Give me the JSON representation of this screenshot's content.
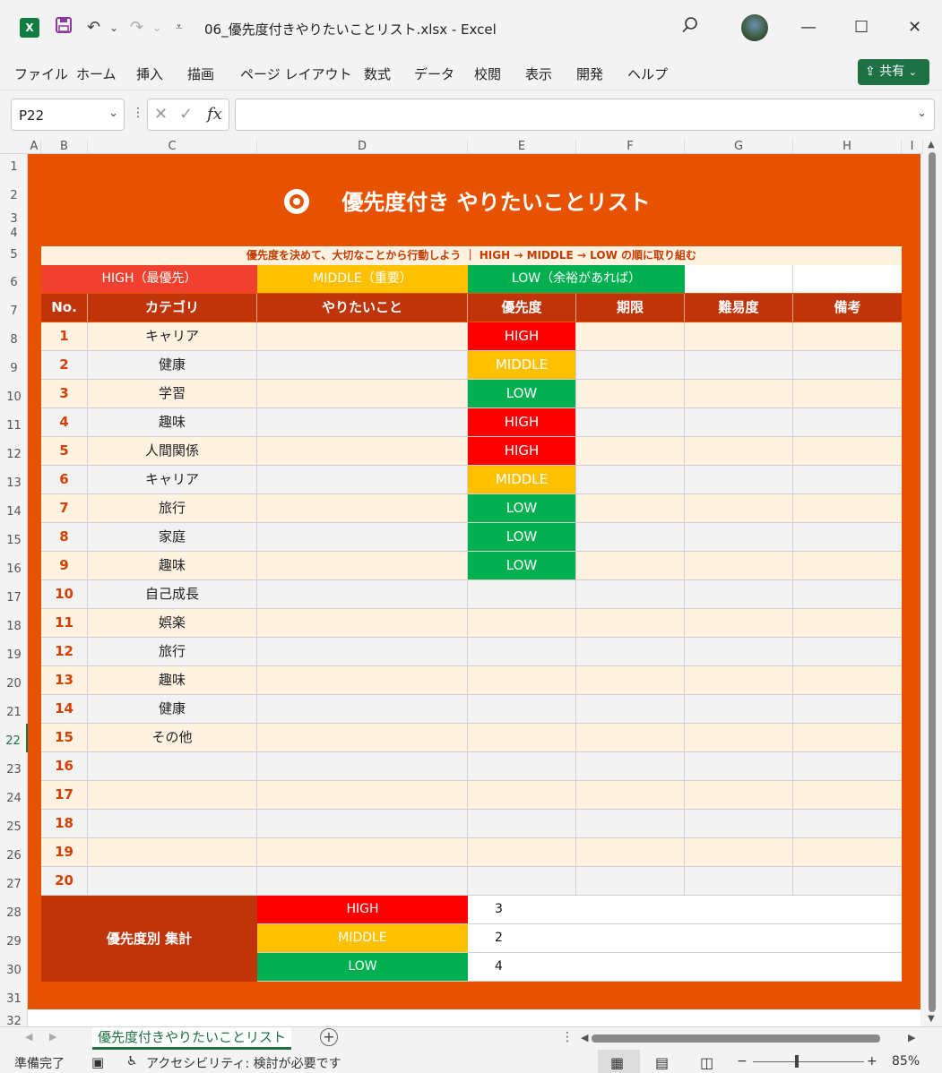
{
  "window": {
    "title": "06_優先度付きやりたいことリスト.xlsx  -  Excel",
    "app_icon": "X",
    "undo_icon": "undo-icon",
    "redo_icon": "redo-icon",
    "minimize": "—",
    "maximize": "☐",
    "close": "✕",
    "search_icon": "⚲"
  },
  "menu": {
    "items": [
      "ファイル",
      "ホーム",
      "挿入",
      "描画",
      "ページ レイアウト",
      "数式",
      "データ",
      "校閲",
      "表示",
      "開発",
      "ヘルプ"
    ],
    "share_label": "共有"
  },
  "formula_bar": {
    "name_box": "P22",
    "cancel": "✕",
    "confirm": "✓",
    "fx": "fx",
    "formula": ""
  },
  "columns": [
    "A",
    "B",
    "C",
    "D",
    "E",
    "F",
    "G",
    "H",
    "I"
  ],
  "rows": [
    "1",
    "2",
    "3",
    "4",
    "5",
    "6",
    "7",
    "8",
    "9",
    "10",
    "11",
    "12",
    "13",
    "14",
    "15",
    "16",
    "17",
    "18",
    "19",
    "20",
    "21",
    "22",
    "23",
    "24",
    "25",
    "26",
    "27",
    "28",
    "29",
    "30",
    "31",
    "32"
  ],
  "sheet": {
    "title": "優先度付き やりたいことリスト",
    "subtitle": "優先度を決めて、大切なことから行動しよう ｜ HIGH → MIDDLE → LOW の順に取り組む",
    "legend": {
      "high": "HIGH（最優先）",
      "middle": "MIDDLE（重要）",
      "low": "LOW（余裕があれば）"
    },
    "headers": [
      "No.",
      "カテゴリ",
      "やりたいこと",
      "優先度",
      "期限",
      "難易度",
      "備考"
    ],
    "rows": [
      {
        "no": "1",
        "category": "キャリア",
        "priority": "HIGH"
      },
      {
        "no": "2",
        "category": "健康",
        "priority": "MIDDLE"
      },
      {
        "no": "3",
        "category": "学習",
        "priority": "LOW"
      },
      {
        "no": "4",
        "category": "趣味",
        "priority": "HIGH"
      },
      {
        "no": "5",
        "category": "人間関係",
        "priority": "HIGH"
      },
      {
        "no": "6",
        "category": "キャリア",
        "priority": "MIDDLE"
      },
      {
        "no": "7",
        "category": "旅行",
        "priority": "LOW"
      },
      {
        "no": "8",
        "category": "家庭",
        "priority": "LOW"
      },
      {
        "no": "9",
        "category": "趣味",
        "priority": "LOW"
      },
      {
        "no": "10",
        "category": "自己成長",
        "priority": ""
      },
      {
        "no": "11",
        "category": "娯楽",
        "priority": ""
      },
      {
        "no": "12",
        "category": "旅行",
        "priority": ""
      },
      {
        "no": "13",
        "category": "趣味",
        "priority": ""
      },
      {
        "no": "14",
        "category": "健康",
        "priority": ""
      },
      {
        "no": "15",
        "category": "その他",
        "priority": ""
      },
      {
        "no": "16",
        "category": "",
        "priority": ""
      },
      {
        "no": "17",
        "category": "",
        "priority": ""
      },
      {
        "no": "18",
        "category": "",
        "priority": ""
      },
      {
        "no": "19",
        "category": "",
        "priority": ""
      },
      {
        "no": "20",
        "category": "",
        "priority": ""
      }
    ],
    "summary": {
      "label": "優先度別 集計",
      "items": [
        {
          "label": "HIGH",
          "value": "3"
        },
        {
          "label": "MIDDLE",
          "value": "2"
        },
        {
          "label": "LOW",
          "value": "4"
        }
      ]
    }
  },
  "colors": {
    "sheet_bg": "#e75200",
    "header_bg": "#c0340a",
    "high": "#ff0000",
    "middle": "#ffc000",
    "low": "#00b050",
    "legend_high": "#f04030",
    "row_odd": "#fff2e0",
    "row_even": "#f2f2f2"
  },
  "tabs": {
    "active": "優先度付きやりたいことリスト",
    "add": "+"
  },
  "status": {
    "ready": "準備完了",
    "accessibility": "アクセシビリティ: 検討が必要です",
    "zoom": "85%"
  }
}
